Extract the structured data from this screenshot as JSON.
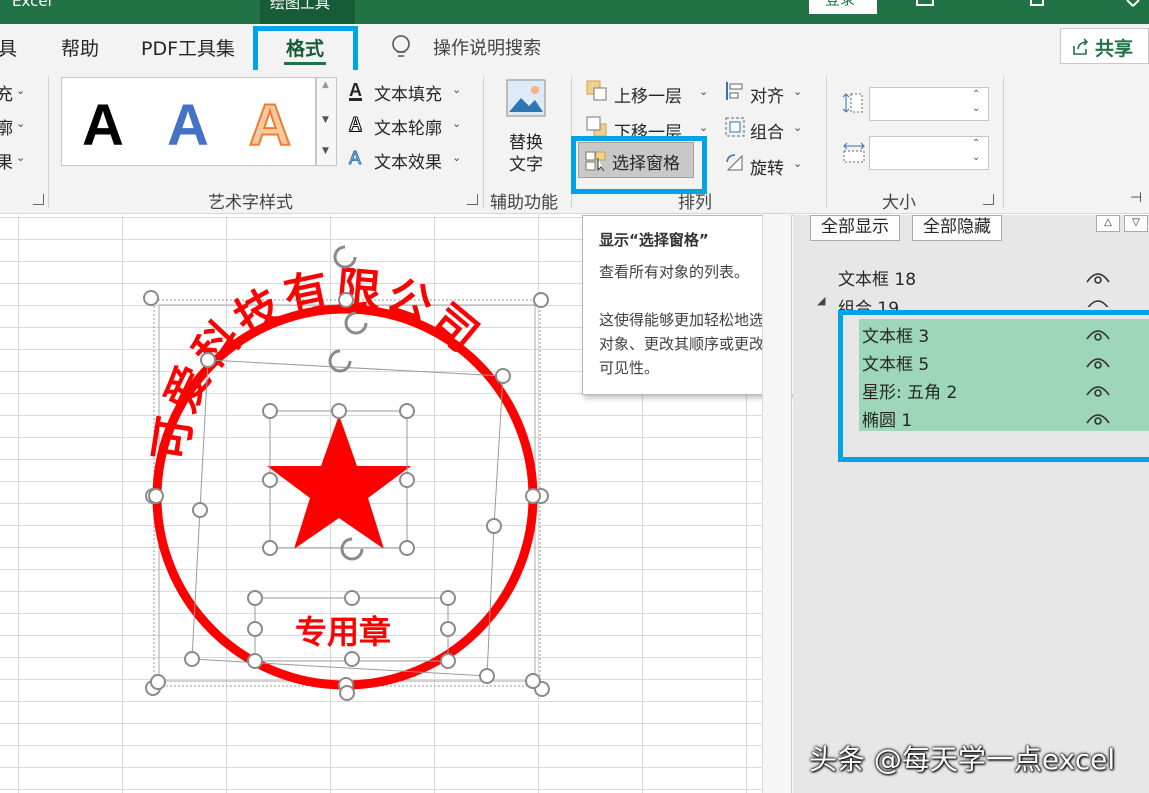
{
  "titlebar": {
    "app_name": "Excel",
    "context_tab": "绘图工具",
    "signin_label": "登录"
  },
  "tabs": [
    {
      "label": "具"
    },
    {
      "label": "帮助"
    },
    {
      "label": "PDF工具集"
    },
    {
      "label": "格式",
      "active": true
    },
    {
      "label": "操作说明搜索"
    }
  ],
  "share_label": "共享",
  "ribbon": {
    "left_partial": [
      "充",
      "廓",
      "果"
    ],
    "wordart_letters": [
      "A",
      "A",
      "A"
    ],
    "text_fill": "文本填充",
    "text_outline": "文本轮廓",
    "text_effect": "文本效果",
    "group_wordart": "艺术字样式",
    "alt_text": [
      "替换",
      "文字"
    ],
    "group_accessibility": "辅助功能",
    "bring_forward": "上移一层",
    "send_backward": "下移一层",
    "selection_pane": "选择窗格",
    "align": "对齐",
    "group": "组合",
    "rotate": "旋转",
    "group_arrange": "排列",
    "height_value": "",
    "width_value": "",
    "group_size": "大小"
  },
  "tooltip": {
    "title": "显示“选择窗格”",
    "line1": "查看所有对象的列表。",
    "line2": "这使得能够更加轻松地选择对象、更改其顺序或更改其可见性。"
  },
  "pane": {
    "show_all": "全部显示",
    "hide_all": "全部隐藏",
    "items": [
      {
        "label": "文本框 18"
      },
      {
        "label": "组合 19"
      },
      {
        "label": "文本框 3"
      },
      {
        "label": "文本框 5"
      },
      {
        "label": "星形: 五角 2"
      },
      {
        "label": "椭圆 1"
      }
    ]
  },
  "stamp": {
    "company": "可爱科技有限公司",
    "subtitle": "专用章",
    "color": "#ff0000"
  },
  "watermark": "头条 @每天学一点excel",
  "colors": {
    "excel_green": "#217346",
    "highlight_blue": "#00a2e8",
    "selected_bg": "#9dd6b8"
  }
}
